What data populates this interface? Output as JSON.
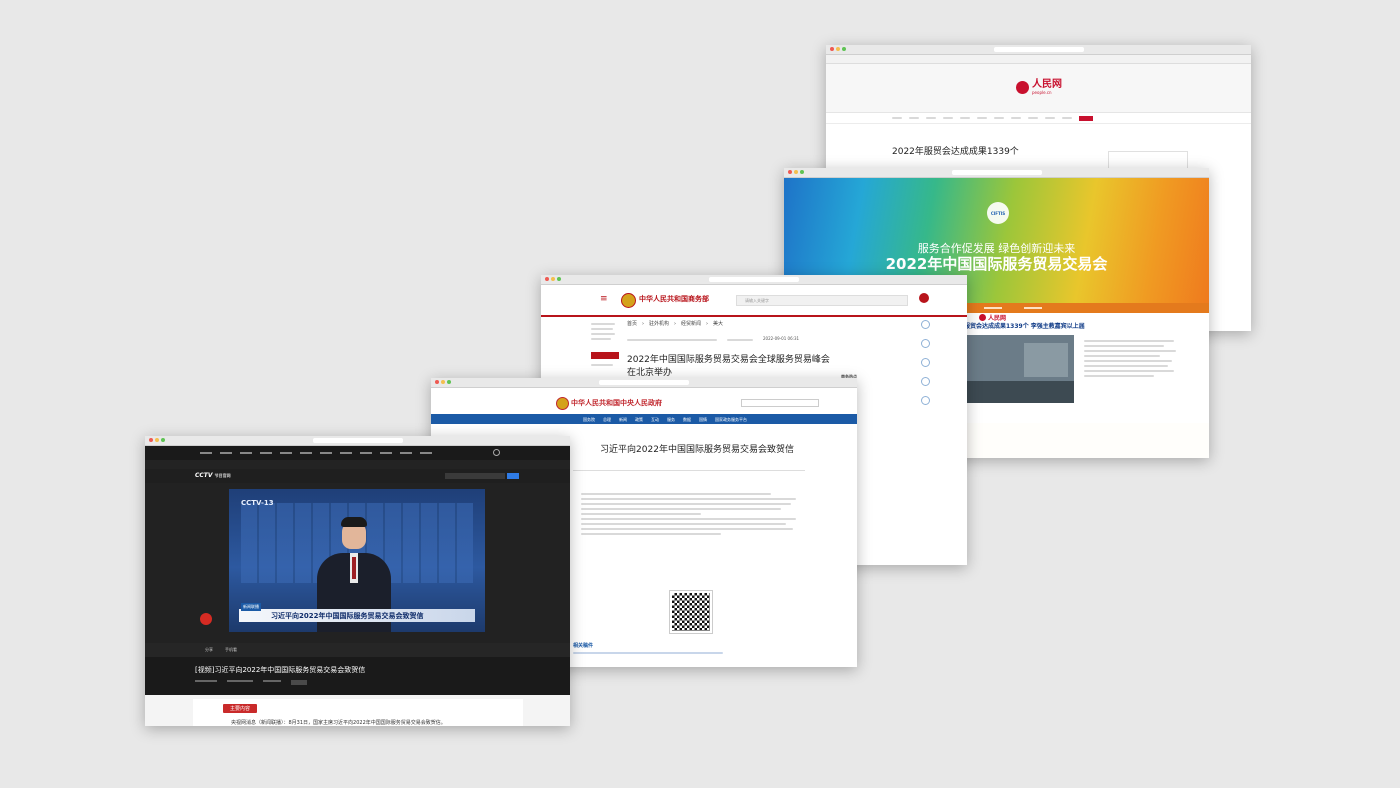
{
  "people": {
    "logo_cn": "人民网",
    "logo_en": "people.cn",
    "headline": "2022年服贸会达成成果1339个"
  },
  "ciftis": {
    "logo": "CIFTIS",
    "slogan": "服务合作促发展 绿色创新迎未来",
    "title": "2022年中国国际服务贸易交易会",
    "people_logo": "人民网",
    "news_headline": "服贸会达成成果1339个 李强主教嘉宾以上届"
  },
  "mofcom": {
    "site_name": "中华人民共和国商务部",
    "search_placeholder": "请输入关键字",
    "breadcrumb": [
      "首页",
      "驻外机构",
      "经贸新闻",
      "美大"
    ],
    "date": "2022-09-01 06:31",
    "headline_line1": "2022年中国国际服务贸易交易会全球服务贸易峰会",
    "headline_line2": "在北京举办",
    "sidebar_title": "商务热点"
  },
  "gov": {
    "site_name": "中华人民共和国中央人民政府",
    "nav": [
      "国务院",
      "总理",
      "新闻",
      "政策",
      "互动",
      "服务",
      "数据",
      "国情",
      "国家政务服务平台"
    ],
    "headline": "习近平向2022年中国国际服务贸易交易会致贺信",
    "related_title": "相关稿件"
  },
  "cctv": {
    "brand": "CCTV",
    "brand_sub": "节目官网",
    "channel_logo": "CCTV-13",
    "ticker_logo": "新闻联播",
    "lower_third": "习近平向2022年中国国际服务贸易交易会致贺信",
    "share": "分享",
    "fav": "手机看",
    "video_title": "[视频]习近平向2022年中国国际服务贸易交易会致贺信",
    "tab": "主要内容",
    "body_text": "央视网消息（新闻联播）：8月31日，国家主席习近平向2022年中国国际服务贸易交易会致贺信。"
  },
  "colors": {
    "people_red": "#c8102e",
    "gov_blue": "#1b5aa6",
    "mofcom_red": "#b8141b",
    "cctv_dark": "#1a1a1a"
  }
}
